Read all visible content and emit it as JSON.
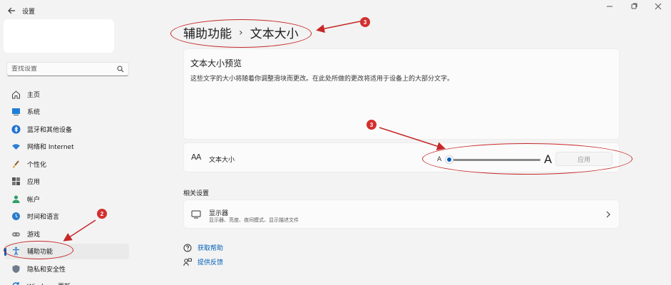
{
  "window": {
    "title": "设置"
  },
  "sidebar": {
    "search_placeholder": "查找设置",
    "items": [
      {
        "label": "主页",
        "icon": "home-icon"
      },
      {
        "label": "系统",
        "icon": "monitor-icon"
      },
      {
        "label": "蓝牙和其他设备",
        "icon": "bluetooth-icon"
      },
      {
        "label": "网络和 Internet",
        "icon": "wifi-icon"
      },
      {
        "label": "个性化",
        "icon": "brush-icon"
      },
      {
        "label": "应用",
        "icon": "apps-icon"
      },
      {
        "label": "帐户",
        "icon": "user-icon"
      },
      {
        "label": "时间和语言",
        "icon": "globe-clock-icon"
      },
      {
        "label": "游戏",
        "icon": "gamepad-icon"
      },
      {
        "label": "辅助功能",
        "icon": "accessibility-icon",
        "active": true
      },
      {
        "label": "隐私和安全性",
        "icon": "shield-icon"
      },
      {
        "label": "Windows 更新",
        "icon": "update-icon"
      }
    ]
  },
  "breadcrumb": {
    "parent": "辅助功能",
    "separator": "›",
    "current": "文本大小"
  },
  "preview": {
    "title": "文本大小预览",
    "description": "这些文字的大小将随着你调整滑块而更改。在此处所做的更改将适用于设备上的大部分文字。"
  },
  "text_size": {
    "label": "文本大小",
    "icon_text": "AA",
    "small_a": "A",
    "big_a": "A",
    "slider_value": 0,
    "apply_label": "应用"
  },
  "related": {
    "title": "相关设置",
    "display": {
      "title": "显示器",
      "subtitle": "显示器、亮度、夜间模式、显示描述文件"
    }
  },
  "help": {
    "get_help": "获取帮助",
    "feedback": "提供反馈"
  },
  "annotations": {
    "badge_top": "3",
    "badge_slider": "3",
    "badge_sidebar": "2"
  },
  "colors": {
    "accent": "#005fb8",
    "annotation": "#c62828"
  }
}
